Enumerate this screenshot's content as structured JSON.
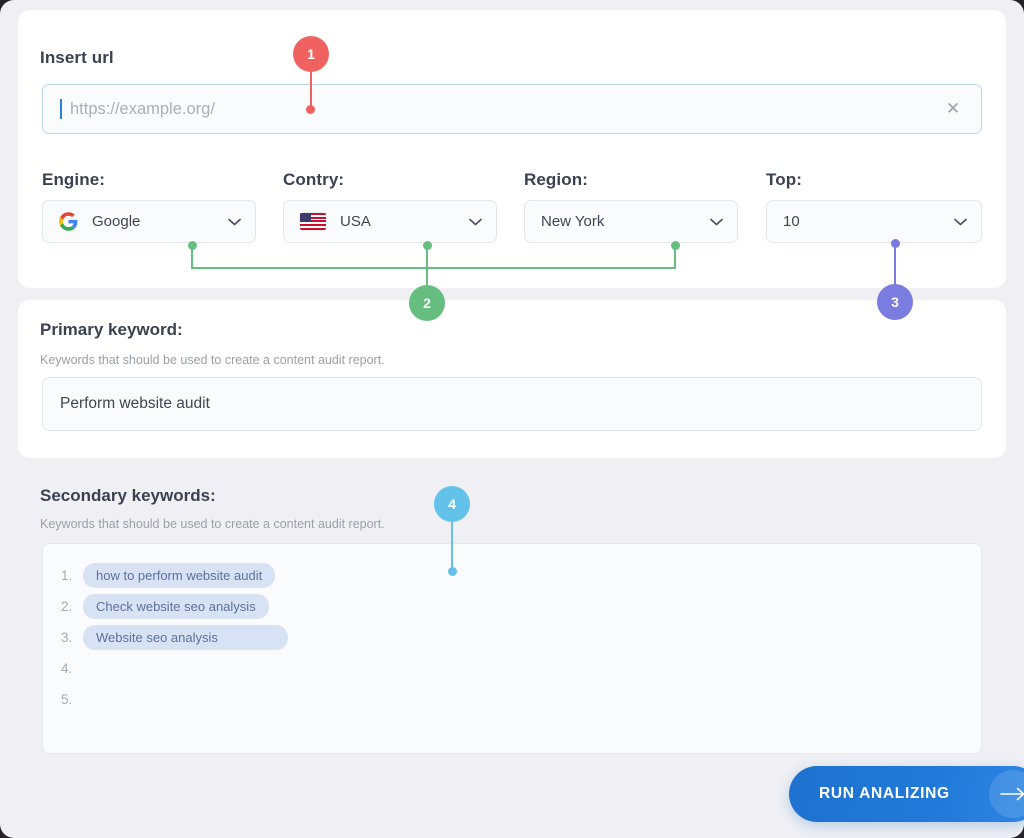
{
  "url_section": {
    "label": "Insert url",
    "placeholder": "https://example.org/",
    "value": "",
    "clear_icon": "close-icon"
  },
  "selects": [
    {
      "key": "engine",
      "label": "Engine:",
      "value": "Google",
      "icon": "google-logo-icon"
    },
    {
      "key": "country",
      "label": "Contry:",
      "value": "USA",
      "icon": "usa-flag-icon"
    },
    {
      "key": "region",
      "label": "Region:",
      "value": "New York",
      "icon": null
    },
    {
      "key": "top",
      "label": "Top:",
      "value": "10",
      "icon": null
    }
  ],
  "primary": {
    "title": "Primary keyword:",
    "subtitle": "Keywords that should be used to create a content audit report.",
    "value": "Perform website audit"
  },
  "secondary": {
    "title": "Secondary keywords:",
    "subtitle": "Keywords that should be used to create a content audit report.",
    "items": [
      {
        "num": "1.",
        "value": "how to perform website audit"
      },
      {
        "num": "2.",
        "value": "Check website seo analysis"
      },
      {
        "num": "3.",
        "value": "Website seo analysis"
      },
      {
        "num": "4.",
        "value": ""
      },
      {
        "num": "5.",
        "value": ""
      }
    ]
  },
  "run_button": {
    "label": "RUN ANALIZING",
    "arrow_icon": "arrow-right-icon"
  },
  "callouts": [
    {
      "number": "1",
      "color": "#f0625f"
    },
    {
      "number": "2",
      "color": "#65bd7f"
    },
    {
      "number": "3",
      "color": "#7b7ce0"
    },
    {
      "number": "4",
      "color": "#62c2ea"
    }
  ],
  "colors": {
    "page_background": "#f0f0f4",
    "card_background": "#ffffff",
    "accent_blue": "#2079d8",
    "pill_background": "#d8e2f5",
    "pill_text": "#5d7296"
  }
}
